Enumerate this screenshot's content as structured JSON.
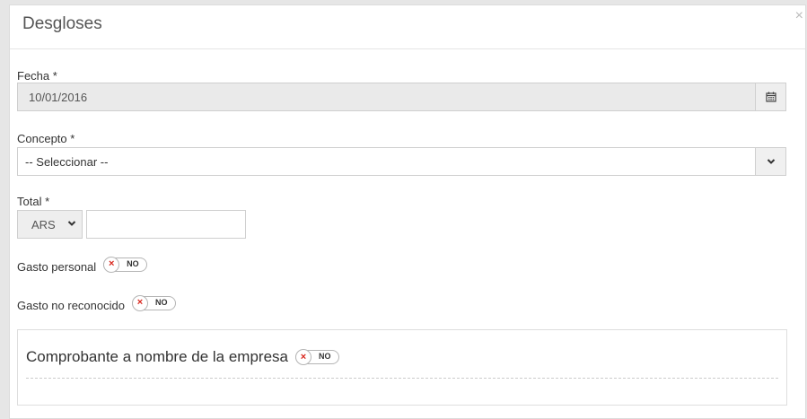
{
  "modal": {
    "title": "Desgloses",
    "close_glyph": "×"
  },
  "form": {
    "fecha": {
      "label": "Fecha *",
      "value": "10/01/2016",
      "icon": "calendar-icon"
    },
    "concepto": {
      "label": "Concepto *",
      "value": "-- Seleccionar --",
      "icon": "chevron-down-icon"
    },
    "total": {
      "label": "Total *",
      "currency": "ARS",
      "amount": ""
    },
    "gasto_personal": {
      "label": "Gasto personal",
      "toggle_text": "NO",
      "toggle_glyph": "×"
    },
    "gasto_no_reconocido": {
      "label": "Gasto no reconocido",
      "toggle_text": "NO",
      "toggle_glyph": "×"
    },
    "comprobante": {
      "label": "Comprobante a nombre de la empresa",
      "toggle_text": "NO",
      "toggle_glyph": "×"
    }
  },
  "colors": {
    "toggle_x": "#d9261c",
    "disabled_bg": "#eaeaea",
    "border": "#cfcfcf"
  }
}
